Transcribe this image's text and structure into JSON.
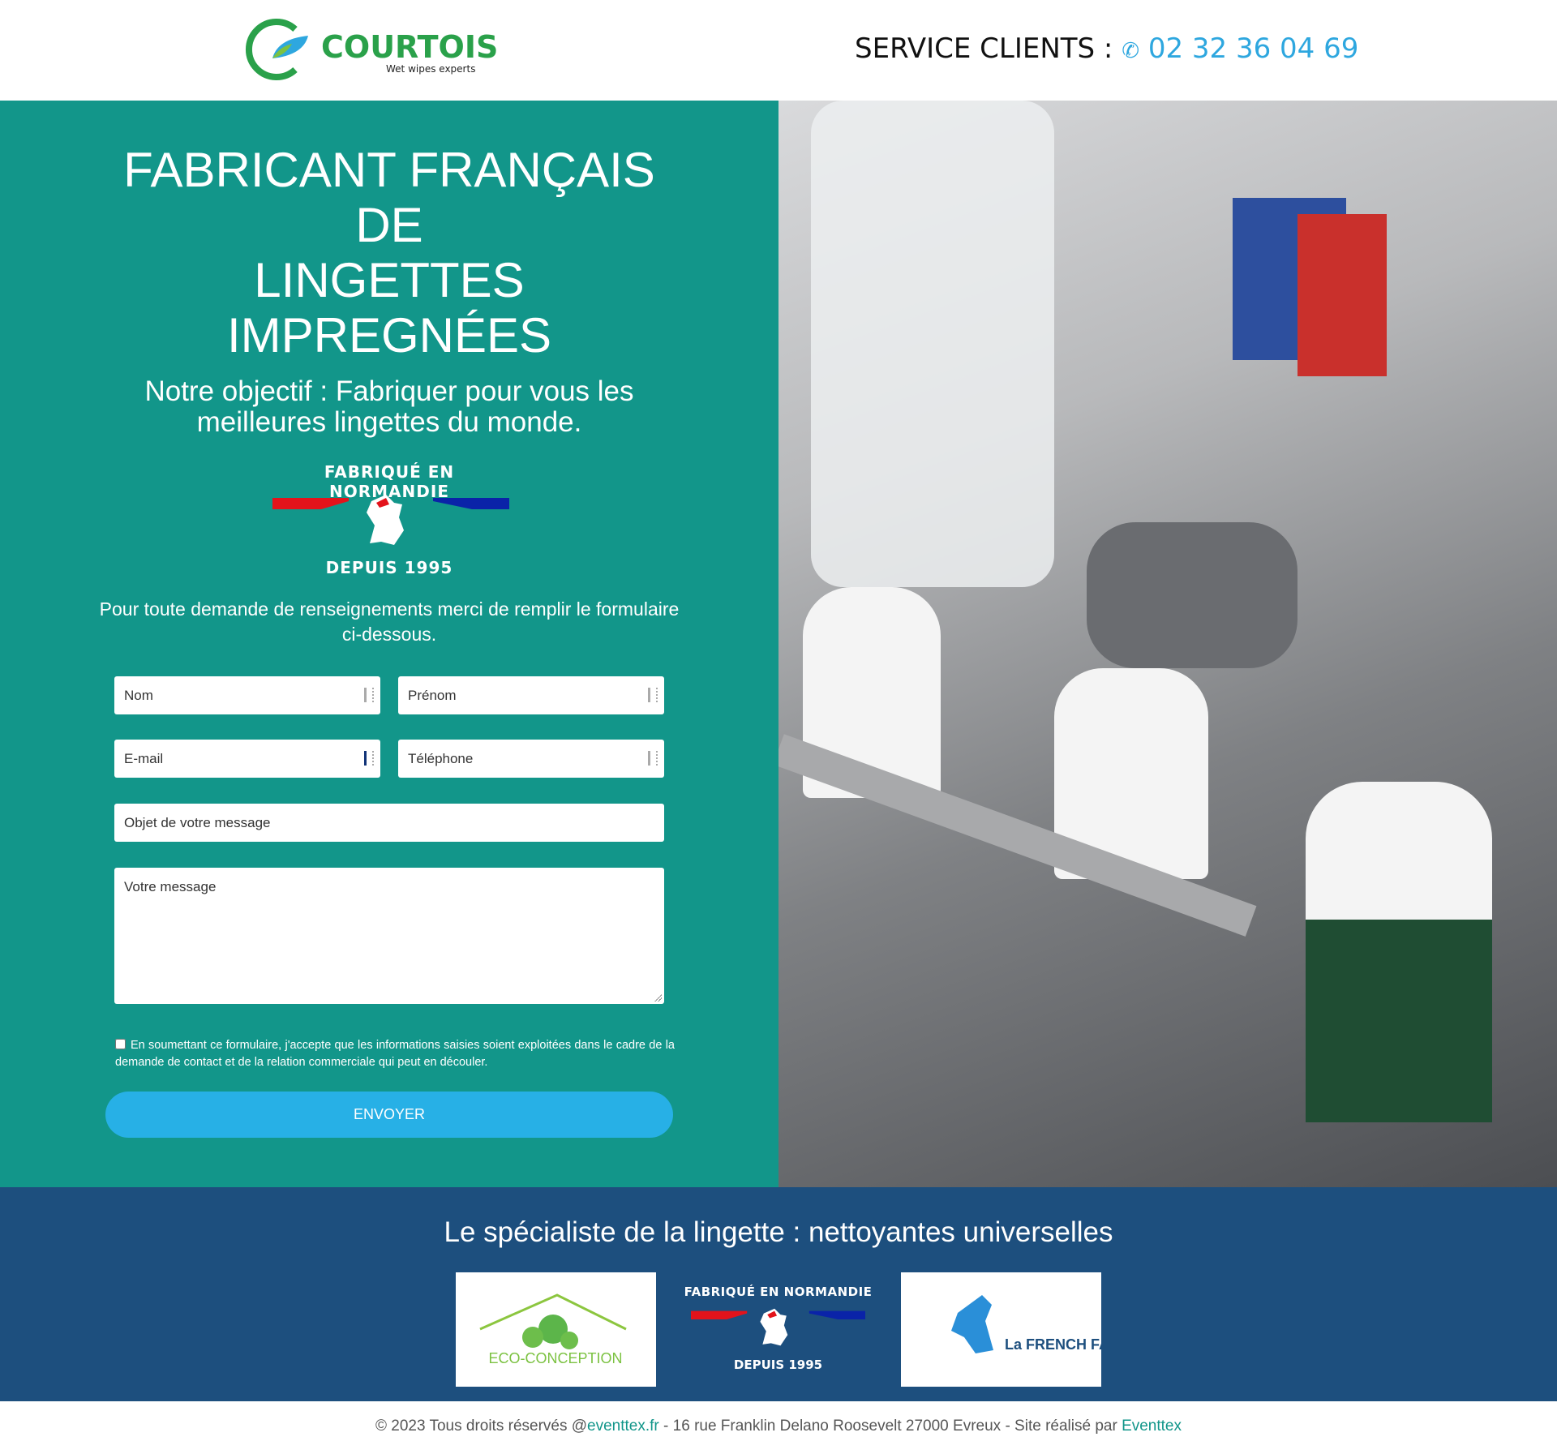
{
  "header": {
    "logo_text": "COURTOIS",
    "logo_tagline": "Wet wipes experts",
    "service_label": "SERVICE CLIENTS :",
    "phone": "02 32 36 04 69",
    "phone_icon": "phone-icon"
  },
  "hero": {
    "title_lines": [
      "FABRICANT FRANÇAIS",
      "DE",
      "LINGETTES",
      "IMPREGNÉES"
    ],
    "subtitle_lines": [
      "Notre objectif : Fabriquer pour vous les",
      "meilleures lingettes du monde."
    ],
    "badge": {
      "top": "FABRIQUÉ EN NORMANDIE",
      "bottom": "DEPUIS 1995"
    },
    "intro": "Pour toute demande de renseignements merci de remplir le formulaire ci-dessous."
  },
  "form": {
    "nom": "Nom",
    "prenom": "Prénom",
    "email": "E-mail",
    "telephone": "Téléphone",
    "objet": "Objet de votre message",
    "message": "Votre message",
    "consent": "En soumettant ce formulaire, j'accepte que les informations saisies soient exploitées dans le cadre de la demande de contact et de la relation commerciale qui peut en découler.",
    "consent_checked": false,
    "submit": "ENVOYER"
  },
  "band": {
    "title": "Le spécialiste de la lingette : nettoyantes universelles",
    "logos": [
      {
        "name": "ECO-CONCEPTION"
      },
      {
        "name": "FABRIQUÉ EN NORMANDIE",
        "sub": "DEPUIS 1995"
      },
      {
        "name": "La FRENCH FAB"
      }
    ]
  },
  "footer": {
    "prefix": "© 2023 Tous droits réservés @",
    "link1": "eventtex.fr",
    "middle": " - 16 rue Franklin Delano Roosevelt 27000 Evreux - Site réalisé par ",
    "link2": "Eventtex"
  },
  "colors": {
    "teal": "#12968a",
    "blue_band": "#1d4f7e",
    "button": "#27b0e6",
    "logo_green": "#2aa14a",
    "phone_blue": "#2ea7df"
  }
}
